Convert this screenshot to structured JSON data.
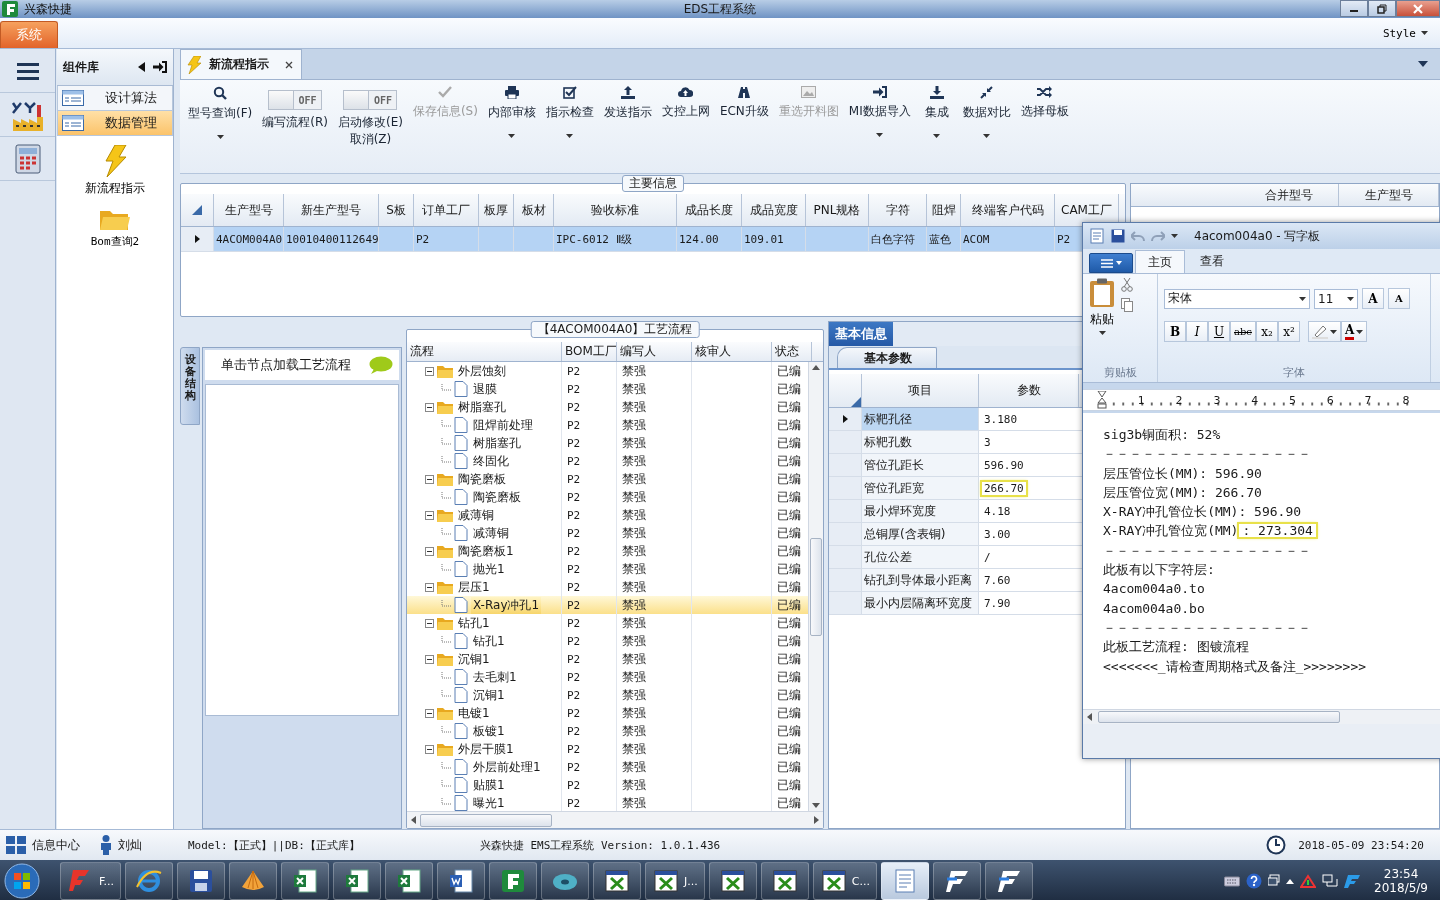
{
  "title_bar": {
    "app_name": "兴森快捷",
    "title": "EDS工程系统"
  },
  "menu_bar": {
    "tab": "系统",
    "style": "Style"
  },
  "sidebar": {
    "header": "组件库",
    "items": [
      {
        "label": "设计算法",
        "selected": false
      },
      {
        "label": "数据管理",
        "selected": true
      }
    ],
    "tools": [
      {
        "label": "新流程指示"
      },
      {
        "label": "Bom查询2"
      }
    ]
  },
  "doc_tab": {
    "label": "新流程指示"
  },
  "toolbar": [
    {
      "kind": "button",
      "label": "型号查询(F)",
      "dropdown": true,
      "disabled": false
    },
    {
      "kind": "toggle",
      "label": "编写流程(R)",
      "on": false,
      "state_text": "OFF"
    },
    {
      "kind": "toggle",
      "label": "启动修改(E)\n取消(Z)",
      "on": false,
      "state_text": "OFF"
    },
    {
      "kind": "button",
      "label": "保存信息(S)",
      "dropdown": false,
      "disabled": true
    },
    {
      "kind": "button",
      "label": "内部审核",
      "dropdown": true,
      "disabled": false
    },
    {
      "kind": "button",
      "label": "指示检查",
      "dropdown": true,
      "disabled": false
    },
    {
      "kind": "button",
      "label": "发送指示",
      "dropdown": false,
      "disabled": false
    },
    {
      "kind": "button",
      "label": "文控上网",
      "dropdown": false,
      "disabled": false
    },
    {
      "kind": "button",
      "label": "ECN升级",
      "dropdown": false,
      "disabled": false
    },
    {
      "kind": "button",
      "label": "重选开料图",
      "dropdown": false,
      "disabled": true
    },
    {
      "kind": "button",
      "label": "MI数据导入",
      "dropdown": true,
      "disabled": false
    },
    {
      "kind": "button",
      "label": "集成",
      "dropdown": true,
      "disabled": false
    },
    {
      "kind": "button",
      "label": "数据对比",
      "dropdown": true,
      "disabled": false
    },
    {
      "kind": "button",
      "label": "选择母板",
      "dropdown": false,
      "disabled": false
    }
  ],
  "main_info": {
    "title": "主要信息",
    "columns": [
      "生产型号",
      "新生产型号",
      "S板",
      "订单工厂",
      "板厚",
      "板材",
      "验收标准",
      "成品长度",
      "成品宽度",
      "PNL规格",
      "字符",
      "阻焊",
      "终端客户代码",
      "CAM工厂"
    ],
    "rows": [
      {
        "selected": true,
        "cells": [
          "4ACOM004A0",
          "10010400112649",
          null,
          "P2",
          null,
          null,
          "IPC-6012 Ⅱ级",
          "124.00",
          "109.01",
          null,
          "白色字符",
          "蓝色",
          "ACOM",
          "P2"
        ]
      }
    ]
  },
  "right_grid": {
    "columns": [
      "合并型号",
      "生产型号"
    ]
  },
  "device_tab": {
    "label": "设备结构"
  },
  "node_panel": {
    "hint": "单击节点加载工艺流程"
  },
  "process": {
    "title": "【4ACOM004A0】工艺流程",
    "columns": [
      "流程",
      "BOM工厂",
      "编写人",
      "核审人",
      "状态"
    ],
    "rows": [
      {
        "label": "外层蚀刻",
        "factory": "P2",
        "author": "禁强",
        "status": "已编",
        "selected": false,
        "expanded": true,
        "children": [
          {
            "label": "退膜",
            "factory": "P2",
            "author": "禁强",
            "status": "已编",
            "selected": false
          }
        ]
      },
      {
        "label": "树脂塞孔",
        "factory": "P2",
        "author": "禁强",
        "status": "已编",
        "selected": false,
        "expanded": true,
        "children": [
          {
            "label": "阻焊前处理",
            "factory": "P2",
            "author": "禁强",
            "status": "已编",
            "selected": false
          },
          {
            "label": "树脂塞孔",
            "factory": "P2",
            "author": "禁强",
            "status": "已编",
            "selected": false
          },
          {
            "label": "终固化",
            "factory": "P2",
            "author": "禁强",
            "status": "已编",
            "selected": false
          }
        ]
      },
      {
        "label": "陶瓷磨板",
        "factory": "P2",
        "author": "禁强",
        "status": "已编",
        "selected": false,
        "expanded": true,
        "children": [
          {
            "label": "陶瓷磨板",
            "factory": "P2",
            "author": "禁强",
            "status": "已编",
            "selected": false
          }
        ]
      },
      {
        "label": "减薄铜",
        "factory": "P2",
        "author": "禁强",
        "status": "已编",
        "selected": false,
        "expanded": true,
        "children": [
          {
            "label": "减薄铜",
            "factory": "P2",
            "author": "禁强",
            "status": "已编",
            "selected": false
          }
        ]
      },
      {
        "label": "陶瓷磨板1",
        "factory": "P2",
        "author": "禁强",
        "status": "已编",
        "selected": false,
        "expanded": true,
        "children": [
          {
            "label": "抛光1",
            "factory": "P2",
            "author": "禁强",
            "status": "已编",
            "selected": false
          }
        ]
      },
      {
        "label": "层压1",
        "factory": "P2",
        "author": "禁强",
        "status": "已编",
        "selected": false,
        "expanded": true,
        "children": [
          {
            "label": "X-Ray冲孔1",
            "factory": "P2",
            "author": "禁强",
            "status": "已编",
            "selected": true
          }
        ]
      },
      {
        "label": "钻孔1",
        "factory": "P2",
        "author": "禁强",
        "status": "已编",
        "selected": false,
        "expanded": true,
        "children": [
          {
            "label": "钻孔1",
            "factory": "P2",
            "author": "禁强",
            "status": "已编",
            "selected": false
          }
        ]
      },
      {
        "label": "沉铜1",
        "factory": "P2",
        "author": "禁强",
        "status": "已编",
        "selected": false,
        "expanded": true,
        "children": [
          {
            "label": "去毛刺1",
            "factory": "P2",
            "author": "禁强",
            "status": "已编",
            "selected": false
          },
          {
            "label": "沉铜1",
            "factory": "P2",
            "author": "禁强",
            "status": "已编",
            "selected": false
          }
        ]
      },
      {
        "label": "电镀1",
        "factory": "P2",
        "author": "禁强",
        "status": "已编",
        "selected": false,
        "expanded": true,
        "children": [
          {
            "label": "板镀1",
            "factory": "P2",
            "author": "禁强",
            "status": "已编",
            "selected": false
          }
        ]
      },
      {
        "label": "外层干膜1",
        "factory": "P2",
        "author": "禁强",
        "status": "已编",
        "selected": false,
        "expanded": true,
        "children": [
          {
            "label": "外层前处理1",
            "factory": "P2",
            "author": "禁强",
            "status": "已编",
            "selected": false
          },
          {
            "label": "贴膜1",
            "factory": "P2",
            "author": "禁强",
            "status": "已编",
            "selected": false
          },
          {
            "label": "曝光1",
            "factory": "P2",
            "author": "禁强",
            "status": "已编",
            "selected": false
          }
        ]
      }
    ]
  },
  "basic_info": {
    "title": "基本信息",
    "tab": "基本参数",
    "columns": [
      "项目",
      "参数"
    ],
    "rows": [
      {
        "item": "标靶孔径",
        "value": "3.180",
        "selected": true,
        "highlighted": false
      },
      {
        "item": "标靶孔数",
        "value": "3",
        "selected": false,
        "highlighted": false
      },
      {
        "item": "管位孔距长",
        "value": "596.90",
        "selected": false,
        "highlighted": false
      },
      {
        "item": "管位孔距宽",
        "value": "266.70",
        "selected": false,
        "highlighted": true
      },
      {
        "item": "最小焊环宽度",
        "value": "4.18",
        "selected": false,
        "highlighted": false
      },
      {
        "item": "总铜厚(含表铜)",
        "value": "3.00",
        "selected": false,
        "highlighted": false
      },
      {
        "item": "孔位公差",
        "value": "/",
        "selected": false,
        "highlighted": false
      },
      {
        "item": "钻孔到导体最小距离",
        "value": "7.60",
        "selected": false,
        "highlighted": false
      },
      {
        "item": "最小内层隔离环宽度",
        "value": "7.90",
        "selected": false,
        "highlighted": false
      }
    ]
  },
  "wordpad": {
    "title": "4acom004a0 - 写字板",
    "tabs": [
      {
        "label": "主页",
        "selected": true
      },
      {
        "label": "查看",
        "selected": false
      }
    ],
    "paste": "粘贴",
    "clipboard_group": "剪贴板",
    "font": "宋体",
    "size": "11",
    "grow": "A",
    "shrink": "A",
    "format_buttons": [
      "B",
      "I",
      "U",
      "abc",
      "x₂",
      "x²"
    ],
    "font_color": "A",
    "font_group": "字体",
    "ruler": [
      "1",
      "2",
      "3",
      "4",
      "5",
      "6",
      "7",
      "8"
    ],
    "lines": [
      {
        "text": "sig3b铜面积: 52%"
      },
      {
        "text": "－－－－－－－－－－－－－－－－"
      },
      {
        "text": "层压管位长(MM): 596.90"
      },
      {
        "text": "层压管位宽(MM): 266.70"
      },
      {
        "text": "X-RAY冲孔管位长(MM): 596.90"
      },
      {
        "text": "X-RAY冲孔管位宽(MM)",
        "value": ": 273.304",
        "highlighted": true
      },
      {
        "text": "－－－－－－－－－－－－－－－－"
      },
      {
        "text": "此板有以下字符层:"
      },
      {
        "text": "4acom004a0.to"
      },
      {
        "text": "4acom004a0.bo"
      },
      {
        "text": "－－－－－－－－－－－－－－－－"
      },
      {
        "text": "此板工艺流程: 图镀流程"
      },
      {
        "text": "<<<<<<<_请检查周期格式及备注_>>>>>>>>"
      }
    ]
  },
  "status_bar": {
    "info": "信息中心",
    "user": "刘灿",
    "model": "Model:【正式】||DB:【正式库】",
    "version": "兴森快捷 EMS工程系统 Version: 1.0.1.436",
    "datetime": "2018-05-09 23:54:20"
  },
  "taskbar": {
    "items": [
      {
        "label": "F...",
        "selected": false
      },
      {
        "selected": false
      },
      {
        "selected": false
      },
      {
        "selected": false
      },
      {
        "selected": false
      },
      {
        "selected": false
      },
      {
        "selected": false
      },
      {
        "selected": false
      },
      {
        "selected": false
      },
      {
        "selected": false
      },
      {
        "selected": false
      },
      {
        "label": "J...",
        "selected": false
      },
      {
        "selected": false
      },
      {
        "selected": false
      },
      {
        "label": "C...",
        "selected": false
      },
      {
        "selected": true
      },
      {
        "selected": false
      },
      {
        "selected": false
      }
    ],
    "time": "23:54",
    "date": "2018/5/9"
  }
}
